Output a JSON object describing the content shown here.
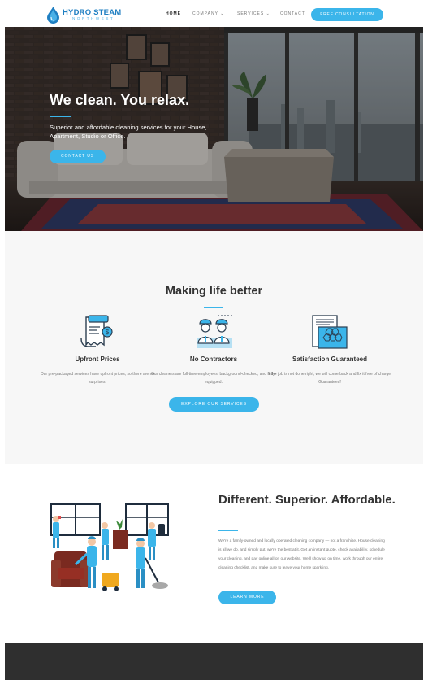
{
  "header": {
    "logo_title": "HYDRO STEAM",
    "logo_subtitle": "NORTHWEST",
    "nav": {
      "home": "HOME",
      "company": "COMPANY",
      "services": "SERVICES",
      "contact": "CONTACT"
    },
    "cta_label": "FREE CONSULTATION"
  },
  "hero": {
    "title": "We clean. You relax.",
    "subtitle": "Superior and affordable cleaning services for your House, Apartment, Studio or Office.",
    "button_label": "CONTACT US"
  },
  "features": {
    "title": "Making life better",
    "items": [
      {
        "title": "Upfront Prices",
        "description": "Our pre-packaged services have upfront prices, so there are no surprises."
      },
      {
        "title": "No Contractors",
        "description": "Our cleaners are full-time employees, background-checked, and fully-equipped."
      },
      {
        "title": "Satisfaction Guaranteed",
        "description": "If the job is not done right, we will come back and fix it free of charge. Guaranteed!"
      }
    ],
    "button_label": "EXPLORE OUR SERVICES"
  },
  "about": {
    "title": "Different. Superior. Affordable.",
    "text": "We're a family-owned and locally operated cleaning company — not a franchise. House cleaning is all we do, and simply put, we're the best at it. Get an instant quote, check availability, schedule your cleaning, and pay online all on our website. We'll show up on time, work through our entire cleaning checklist, and make sure to leave your home sparkling.",
    "button_label": "LEARN MORE"
  },
  "colors": {
    "accent": "#3bb5ea",
    "brand": "#1f7fc2",
    "footer": "#2f2f2f"
  }
}
